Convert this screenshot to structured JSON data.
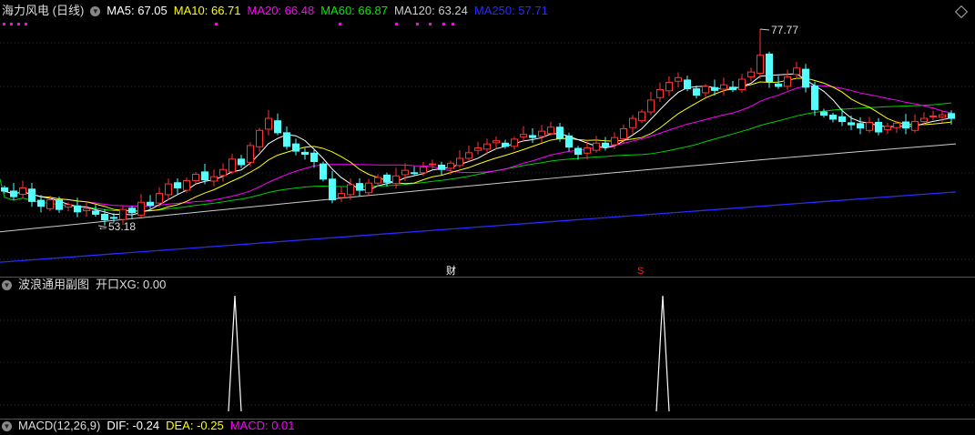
{
  "header": {
    "stock_name": "海力风电 (日线)",
    "ma": [
      {
        "label": "MA5: 67.05",
        "color": "#ffffff"
      },
      {
        "label": "MA10: 66.71",
        "color": "#ffff00"
      },
      {
        "label": "MA20: 66.48",
        "color": "#ff00ff"
      },
      {
        "label": "MA60: 66.87",
        "color": "#00e000"
      },
      {
        "label": "MA120: 63.24",
        "color": "#cccccc"
      },
      {
        "label": "MA250: 57.71",
        "color": "#2a2aff"
      }
    ]
  },
  "main_chart": {
    "high_label": "77.77",
    "low_label": "53.18",
    "high_index": 83,
    "low_index": 11,
    "high_value": 77.77,
    "low_value": 53.18,
    "closes": [
      57.5,
      56.8,
      57.9,
      56.2,
      55.6,
      56.4,
      55.2,
      55.8,
      54.9,
      55.3,
      54.6,
      53.9,
      54.1,
      55.2,
      54.8,
      56.1,
      55.7,
      57.2,
      58.4,
      57.9,
      58.8,
      59.6,
      58.9,
      59.3,
      60.2,
      61.5,
      60.8,
      63.2,
      65.1,
      66.6,
      64.8,
      63.1,
      62.5,
      62.1,
      61.2,
      59.0,
      56.4,
      57.2,
      58.3,
      57.6,
      58.5,
      59.2,
      58.6,
      59.4,
      60.1,
      59.8,
      60.5,
      60.9,
      60.2,
      61.0,
      61.6,
      62.3,
      62.9,
      63.4,
      63.8,
      63.1,
      64.0,
      64.6,
      64.2,
      65.0,
      65.5,
      64.1,
      63.0,
      62.1,
      62.9,
      63.5,
      63.0,
      64.2,
      65.3,
      66.6,
      67.4,
      68.9,
      70.2,
      71.1,
      71.7,
      70.3,
      69.5,
      70.6,
      70.1,
      70.8,
      70.2,
      71.5,
      72.4,
      74.5,
      71.2,
      70.6,
      71.8,
      72.9,
      70.5,
      67.7,
      67.0,
      66.5,
      66.2,
      65.8,
      65.4,
      66.1,
      64.9,
      65.6,
      66.0,
      65.4,
      66.2,
      66.6,
      66.9,
      67.05,
      66.6
    ],
    "ma120_range": [
      52.4,
      63.4
    ],
    "ma250_range": [
      48.6,
      57.4
    ],
    "event_markers": [
      {
        "label": "财",
        "index": 49,
        "color": "#ffffff"
      },
      {
        "label": "S",
        "index": 70,
        "color": "#ff2020"
      }
    ],
    "signal_dot_indices": [
      0,
      2,
      4,
      6,
      70,
      111,
      129,
      136,
      140,
      145,
      148
    ]
  },
  "sub_chart": {
    "title": "波浪通用副图",
    "indicator": "开口XG: 0.00",
    "spike_indices": [
      27,
      74
    ]
  },
  "macd": {
    "title": "MACD(12,26,9)",
    "dif": "DIF: -0.24",
    "dea": "DEA: -0.25",
    "macd": "MACD: 0.01"
  }
}
